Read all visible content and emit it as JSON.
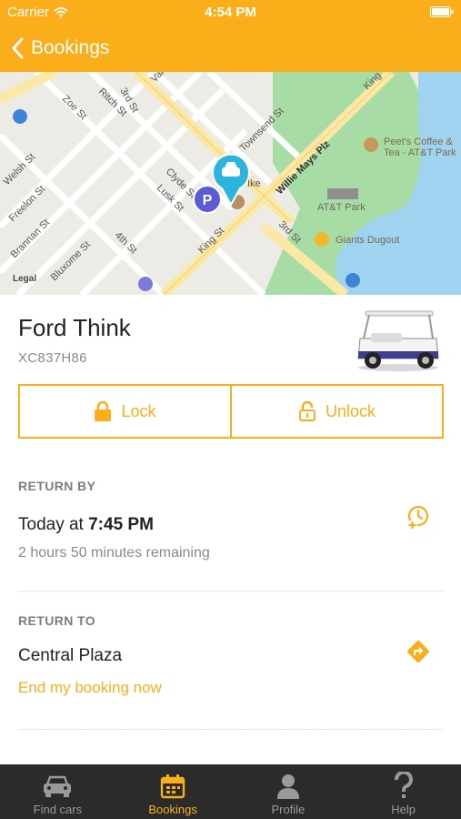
{
  "status_bar": {
    "carrier": "Carrier",
    "time": "4:54 PM"
  },
  "nav": {
    "back_label": "Bookings"
  },
  "map": {
    "legal": "Legal",
    "streets": [
      "3rd St",
      "Zoe St",
      "Ritch St",
      "Varney",
      "Townsend St",
      "Willie Mays Plz",
      "Welsh St",
      "Freelon St",
      "Brannan St",
      "Clyde St",
      "Lusk St",
      "4th St",
      "King St",
      "Bluxome St",
      "3rd St",
      "King",
      "Ike"
    ],
    "pois": [
      "AT&T Park",
      "Peet's Coffee &",
      "Tea - AT&T Park",
      "Giants Dugout"
    ],
    "colors": {
      "park": "#a8dca5",
      "water": "#9fd3f0",
      "road": "#fbe8a5",
      "land": "#ecebe6",
      "car_pin": "#2bb5dd",
      "parking_pin": "#5b5bd6"
    }
  },
  "vehicle": {
    "name": "Ford Think",
    "plate": "XC837H86",
    "image": "white-electric-cart"
  },
  "actions": {
    "lock": "Lock",
    "unlock": "Unlock"
  },
  "return_by": {
    "label": "RETURN BY",
    "day": "Today at",
    "time": "7:45 PM",
    "remaining": "2 hours 50 minutes remaining",
    "icon": "clock-add-icon"
  },
  "return_to": {
    "label": "RETURN TO",
    "place": "Central Plaza",
    "end_link": "End my booking now",
    "icon": "directions-icon"
  },
  "tabs": [
    {
      "label": "Find cars",
      "icon": "car-icon"
    },
    {
      "label": "Bookings",
      "icon": "calendar-icon",
      "active": true
    },
    {
      "label": "Profile",
      "icon": "person-icon"
    },
    {
      "label": "Help",
      "icon": "question-icon"
    }
  ],
  "accent_color": "#f9ae1a"
}
